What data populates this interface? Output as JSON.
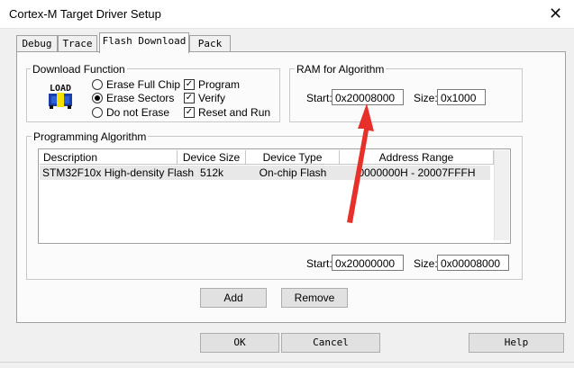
{
  "window": {
    "title": "Cortex-M Target Driver Setup",
    "close_glyph": "✕"
  },
  "tabs": [
    {
      "label": "Debug"
    },
    {
      "label": "Trace"
    },
    {
      "label": "Flash Download"
    },
    {
      "label": "Pack"
    }
  ],
  "download_function": {
    "legend": "Download Function",
    "icon_text": "LOAD",
    "radios": [
      {
        "label": "Erase Full Chip",
        "checked": false
      },
      {
        "label": "Erase Sectors",
        "checked": true
      },
      {
        "label": "Do not Erase",
        "checked": false
      }
    ],
    "checks": [
      {
        "label": "Program",
        "checked": true
      },
      {
        "label": "Verify",
        "checked": true
      },
      {
        "label": "Reset and Run",
        "checked": true
      }
    ],
    "check_glyph": "✓"
  },
  "ram_for_algorithm": {
    "legend": "RAM for Algorithm",
    "start_label": "Start:",
    "start_value": "0x20008000",
    "size_label": "Size:",
    "size_value": "0x1000"
  },
  "programming_algorithm": {
    "legend": "Programming Algorithm",
    "columns": [
      "Description",
      "Device Size",
      "Device Type",
      "Address Range"
    ],
    "rows": [
      {
        "description": "STM32F10x High-density Flash",
        "device_size": "512k",
        "device_type": "On-chip Flash",
        "address_range": "0000000H - 20007FFFH"
      }
    ],
    "start_label": "Start:",
    "start_value": "0x20000000",
    "size_label": "Size:",
    "size_value": "0x00008000",
    "add_label": "Add",
    "remove_label": "Remove"
  },
  "footer": {
    "ok_label": "OK",
    "cancel_label": "Cancel",
    "help_label": "Help"
  },
  "annotation": {
    "arrow_color": "#e8302a"
  }
}
